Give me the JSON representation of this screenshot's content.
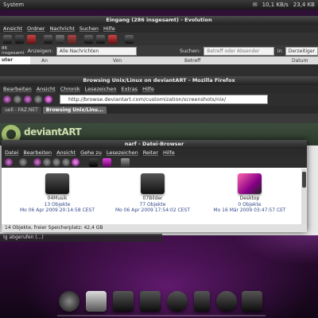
{
  "top_panel": {
    "system_label": "System",
    "net_down": "10,1 KB/s",
    "net_up": "23,4 KB"
  },
  "evolution": {
    "title": "Eingang (286 insgesamt) - Evolution",
    "menu": [
      "Ansicht",
      "Ordner",
      "Nachricht",
      "Suchen",
      "Hilfe"
    ],
    "filter_show_label": "Anzeigen:",
    "filter_show_value": "Alle Nachrichten",
    "search_label": "Suchen:",
    "search_placeholder": "Betreff oder Absender",
    "search_in": "in",
    "search_scope": "Derzeitiger",
    "folder_count": "86 insgesamt",
    "folder_label": "uter",
    "columns": [
      "An",
      "Von",
      "Betreff",
      "Datum"
    ]
  },
  "firefox": {
    "title": "Browsing Unix/Linux on deviantART - Mozilla Firefox",
    "menu": [
      "Bearbeiten",
      "Ansicht",
      "Chronik",
      "Lesezeichen",
      "Extras",
      "Hilfe"
    ],
    "url": "http://browse.deviantart.com/customization/screenshots/nix/",
    "tabs": [
      "uell - FAZ.NET",
      "Browsing Unix/Linu..."
    ],
    "status": "Ig abgerufen (...)",
    "banner_text": "deviantART"
  },
  "nautilus": {
    "title": "narf - Datei-Browser",
    "menu": [
      "Datei",
      "Bearbeiten",
      "Ansicht",
      "Gehe zu",
      "Lesezeichen",
      "Reiter",
      "Hilfe"
    ],
    "files": [
      {
        "name": "04Musik",
        "count": "13 Objekte",
        "date": "Mo 06 Apr 2009 20:14:58 CEST"
      },
      {
        "name": "07Bilder",
        "count": "77 Objekte",
        "date": "Mo 06 Apr 2009 17:54:02 CEST"
      },
      {
        "name": "Desktop",
        "count": "0 Objekte",
        "date": "Mo 16 Mär 2009 03:47:57 CET"
      }
    ],
    "status": "14 Objekte, freier Speicherplatz: 42,4 GB"
  },
  "dock": {
    "items": [
      "finder-icon",
      "portrait-icon",
      "typewriter-icon",
      "calculator-icon",
      "gear-icon",
      "guitar-icon",
      "headphones-icon",
      "document-icon"
    ]
  },
  "colors": {
    "accent_purple": "#9b2fb0",
    "link_blue": "#334a8a"
  }
}
